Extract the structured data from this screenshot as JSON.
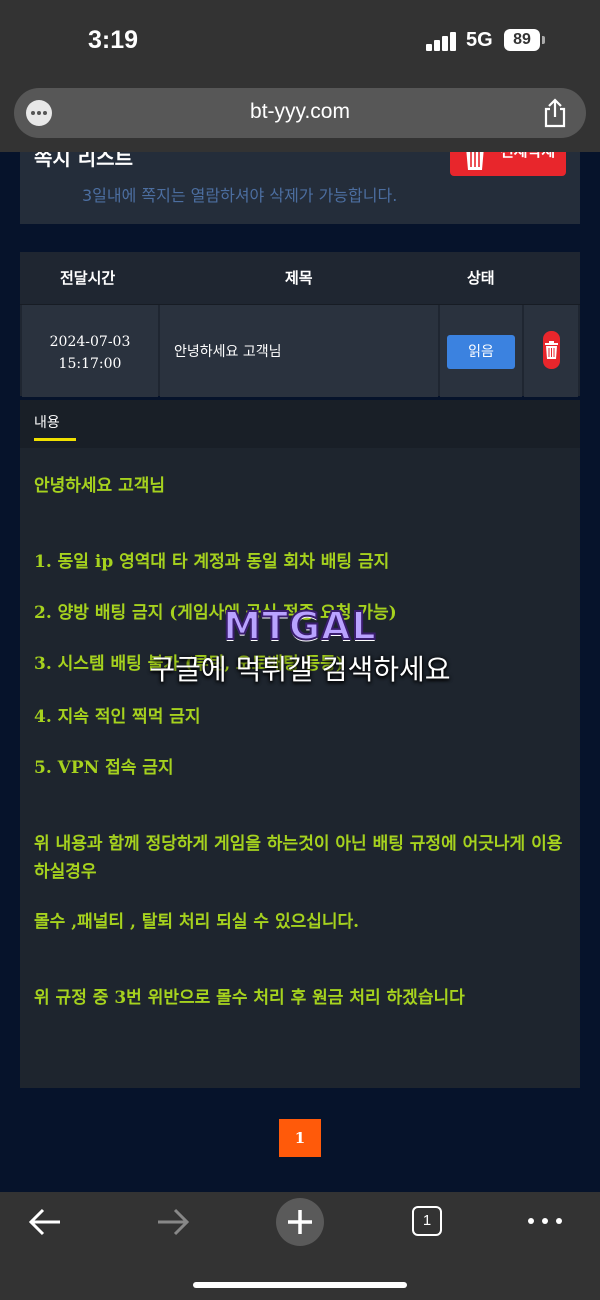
{
  "status_bar": {
    "time": "3:19",
    "network": "5G",
    "battery": "89"
  },
  "url_bar": {
    "url": "bt-yyy.com",
    "more_icon": "ellipsis-icon",
    "share_icon": "share-icon"
  },
  "message_list": {
    "title": "쪽지 리스트",
    "notice": "3일내에 쪽지는 열람하셔야 삭제가 가능합니다.",
    "delete_all_label": "전체삭제"
  },
  "table": {
    "headers": [
      "전달시간",
      "제목",
      "상태"
    ],
    "rows": [
      {
        "date": "2024-07-03",
        "time": "15:17:00",
        "subject": "안녕하세요 고객님",
        "status": "읽음"
      }
    ]
  },
  "content": {
    "tab_label": "내용",
    "lines": [
      "안녕하세요 고객님",
      "1. 동일 ip 영역대 타 계정과 동일 회차 배팅 금지",
      "2. 양방 배팅 금지 (게임사에 공식 적중 요청 가능)",
      "3. 시스템 배팅 불가 (루틴, 오토배팅 등등)",
      "4. 지속 적인 찍먹 금지",
      "5. VPN 접속 금지",
      "위 내용과 함께 정당하게 게임을 하는것이 아닌 배팅 규정에 어긋나게 이용 하실경우",
      "몰수 ,패널티 , 탈퇴 처리 되실 수 있으십니다.",
      "위 규정 중 3번 위반으로 몰수 처리 후 원금 처리 하겠습니다"
    ]
  },
  "watermark": {
    "logo": "MTGAL",
    "caption": "구글에 먹튀갤 검색하세요"
  },
  "pagination": {
    "current": "1"
  },
  "bottom_bar": {
    "tab_count": "1"
  },
  "colors": {
    "accent_text": "#a6d21e",
    "delete_red": "#e8262c",
    "read_blue": "#3b82e0",
    "pager_orange": "#ff5a0a",
    "page_bg": "#06132b"
  }
}
